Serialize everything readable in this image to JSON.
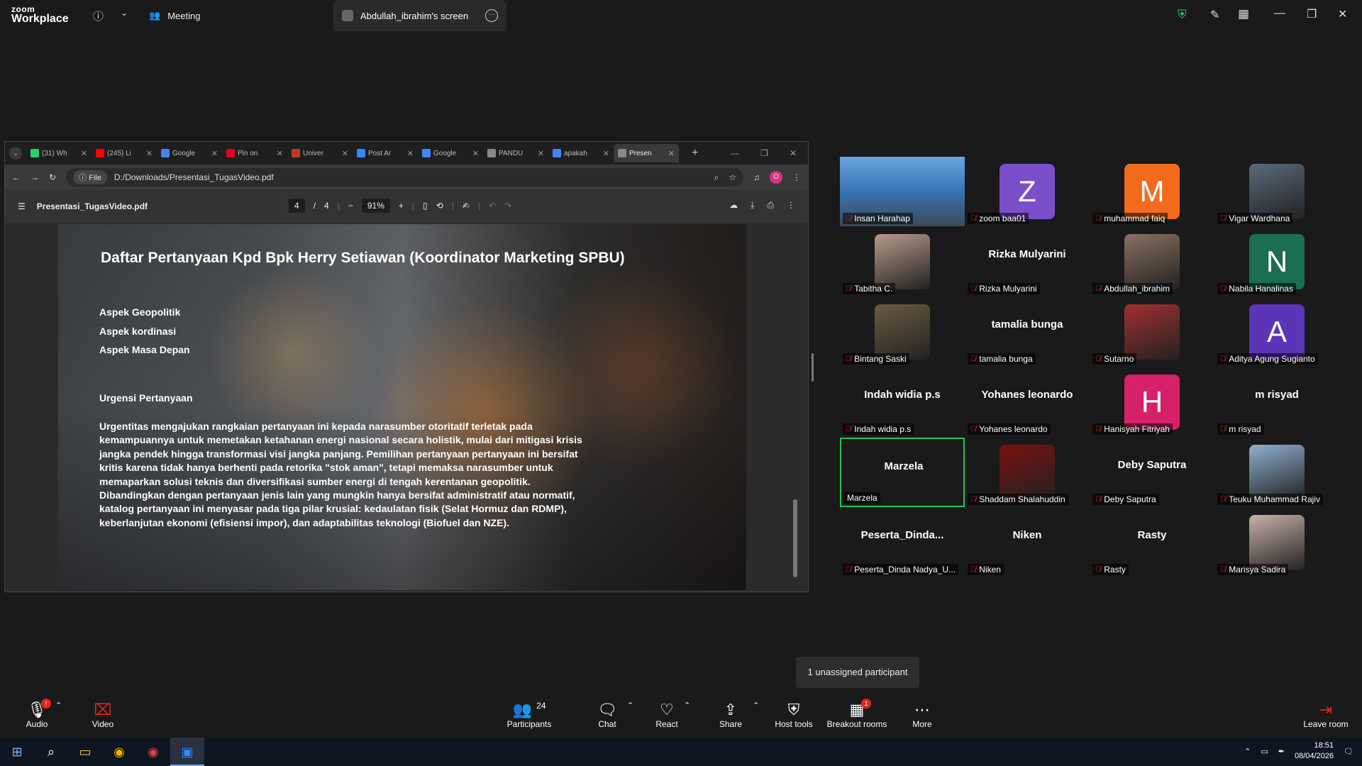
{
  "zoom": {
    "logo_top": "zoom",
    "logo_bottom": "Workplace",
    "meeting_tab": "Meeting",
    "screen_tab": "Abdullah_ibrahim's screen",
    "tooltip": "1 unassigned participant"
  },
  "browser": {
    "tabs": [
      {
        "label": "(31) Wh",
        "color": "#25d366"
      },
      {
        "label": "(245) Li",
        "color": "#ff0000"
      },
      {
        "label": "Google",
        "color": "#4285f4"
      },
      {
        "label": "Pin on",
        "color": "#e60023"
      },
      {
        "label": "Univer",
        "color": "#c0392b"
      },
      {
        "label": "Post Ar",
        "color": "#2d8cff"
      },
      {
        "label": "Google",
        "color": "#4285f4"
      },
      {
        "label": "PANDU",
        "color": "#888888"
      },
      {
        "label": "apakah",
        "color": "#4285f4"
      },
      {
        "label": "Presen",
        "color": "#888888"
      }
    ],
    "file_chip": "File",
    "url": "D:/Downloads/Presentasi_TugasVideo.pdf",
    "profile_letter": "O"
  },
  "pdf": {
    "filename": "Presentasi_TugasVideo.pdf",
    "page": "4",
    "page_sep": "/",
    "total": "4",
    "zoom": "91%"
  },
  "slide": {
    "title": "Daftar Pertanyaan Kpd Bpk Herry Setiawan (Koordinator Marketing SPBU)",
    "aspects": [
      "Aspek Geopolitik",
      "Aspek kordinasi",
      "Aspek Masa Depan"
    ],
    "subtitle": "Urgensi Pertanyaan",
    "paragraph": "Urgentitas mengajukan rangkaian pertanyaan ini kepada narasumber otoritatif terletak pada kemampuannya untuk memetakan ketahanan energi nasional secara holistik, mulai dari mitigasi krisis jangka pendek hingga transformasi visi jangka panjang. Pemilihan pertanyaan pertanyaan ini bersifat kritis karena tidak hanya berhenti pada retorika \"stok aman\", tetapi memaksa narasumber untuk memaparkan solusi teknis dan diversifikasi sumber energi di tengah kerentanan geopolitik. Dibandingkan dengan pertanyaan jenis lain yang mungkin hanya bersifat administratif atau normatif, katalog pertanyaan ini menyasar pada tiga pilar krusial: kedaulatan fisik (Selat Hormuz dan RDMP), keberlanjutan ekonomi (efisiensi impor), dan adaptabilitas teknologi (Biofuel dan NZE)."
  },
  "participants": [
    {
      "label": "Insan Harahap",
      "kind": "video",
      "color": "#3a78b8"
    },
    {
      "label": "zoom baa01",
      "kind": "letter",
      "letter": "Z",
      "color": "#7b4fc9"
    },
    {
      "label": "muhammad faiq",
      "kind": "letter",
      "letter": "M",
      "color": "#f26b1d"
    },
    {
      "label": "Vigar Wardhana",
      "kind": "photo",
      "color": "#5a6a7a"
    },
    {
      "label": "Tabitha C.",
      "kind": "photo",
      "color": "#b89a8a"
    },
    {
      "label": "Rizka Mulyarini",
      "kind": "name"
    },
    {
      "label": "Abdullah_ibrahim",
      "kind": "photo",
      "color": "#8a7060"
    },
    {
      "label": "Nabila Hanalinas",
      "kind": "letter",
      "letter": "N",
      "color": "#1b6e4f"
    },
    {
      "label": "Bintang Saski",
      "kind": "photo",
      "color": "#6a5a40"
    },
    {
      "label": "tamalia bunga",
      "kind": "name"
    },
    {
      "label": "Sutarno",
      "kind": "photo",
      "color": "#a03030"
    },
    {
      "label": "Aditya Agung Sugianto",
      "kind": "letter",
      "letter": "A",
      "color": "#5b34b8"
    },
    {
      "label": "Indah widia p.s",
      "kind": "name"
    },
    {
      "label": "Yohanes leonardo",
      "kind": "name"
    },
    {
      "label": "Hanisyah Fitriyah",
      "kind": "letter",
      "letter": "H",
      "color": "#d6206a"
    },
    {
      "label": "m risyad",
      "kind": "name"
    },
    {
      "label": "Marzela",
      "kind": "name",
      "active": true
    },
    {
      "label": "Shaddam Shalahuddin",
      "kind": "photo",
      "color": "#7a1010"
    },
    {
      "label": "Deby Saputra",
      "kind": "name"
    },
    {
      "label": "Teuku Muhammad Rajiv",
      "kind": "photo",
      "color": "#8fb0d0"
    },
    {
      "label": "Peserta_Dinda Nadya_U...",
      "kind": "name",
      "display": "Peserta_Dinda..."
    },
    {
      "label": "Niken",
      "kind": "name"
    },
    {
      "label": "Rasty",
      "kind": "name"
    },
    {
      "label": "Marisya Sadira",
      "kind": "photo",
      "color": "#c8b0a8"
    }
  ],
  "toolbar": {
    "audio": "Audio",
    "video": "Video",
    "participants": "Participants",
    "participants_count": "24",
    "chat": "Chat",
    "react": "React",
    "share": "Share",
    "host_tools": "Host tools",
    "breakout": "Breakout rooms",
    "breakout_badge": "1",
    "more": "More",
    "leave": "Leave room"
  },
  "taskbar": {
    "time": "18:51",
    "date": "08/04/2026"
  }
}
